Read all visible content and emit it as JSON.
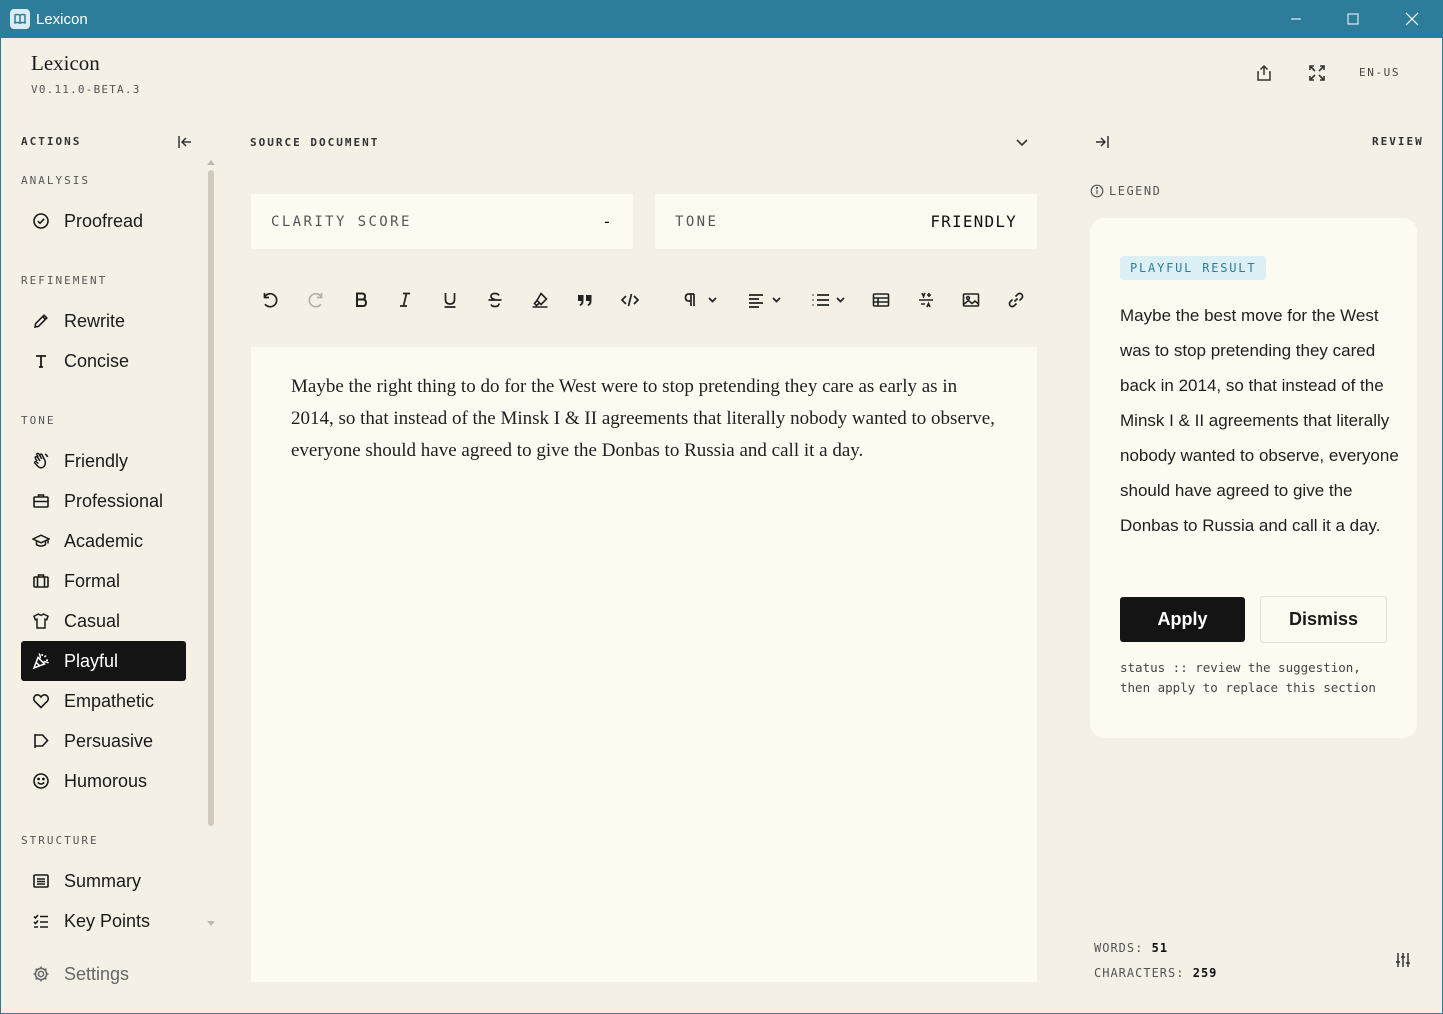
{
  "window": {
    "title": "Lexicon"
  },
  "header": {
    "brand": "Lexicon",
    "version": "V0.11.0-BETA.3",
    "language": "EN-US"
  },
  "sidebar": {
    "title": "ACTIONS",
    "groups": {
      "analysis": {
        "label": "ANALYSIS",
        "items": [
          "Proofread"
        ]
      },
      "refinement": {
        "label": "REFINEMENT",
        "items": [
          "Rewrite",
          "Concise"
        ]
      },
      "tone": {
        "label": "TONE",
        "items": [
          "Friendly",
          "Professional",
          "Academic",
          "Formal",
          "Casual",
          "Playful",
          "Empathetic",
          "Persuasive",
          "Humorous"
        ],
        "active": "Playful"
      },
      "structure": {
        "label": "STRUCTURE",
        "items": [
          "Summary",
          "Key Points"
        ]
      }
    },
    "settings": "Settings"
  },
  "main": {
    "title": "SOURCE DOCUMENT",
    "clarity": {
      "label": "CLARITY SCORE",
      "value": "-"
    },
    "tone": {
      "label": "TONE",
      "value": "FRIENDLY"
    },
    "document": "Maybe the right thing to do for the West were to stop pretending they care as early as in 2014, so that instead of the Minsk I & II agreements that literally nobody wanted to observe, everyone should have agreed to give the Donbas to Russia and call it a day."
  },
  "review": {
    "title": "REVIEW",
    "legend": "LEGEND",
    "badge": "PLAYFUL RESULT",
    "result": "Maybe the best move for the West was to stop pretending they cared back in 2014, so that instead of the Minsk I & II agreements that literally nobody wanted to observe, everyone should have agreed to give the Donbas to Russia and call it a day.",
    "apply": "Apply",
    "dismiss": "Dismiss",
    "status": "status :: review the suggestion, then apply to replace this section",
    "words_label": "WORDS:",
    "words": "51",
    "chars_label": "CHARACTERS:",
    "chars": "259"
  },
  "colors": {
    "titlebar": "#2d7d9a",
    "background": "#f5f0e6",
    "panel": "#fdfaf1",
    "active": "#141414",
    "badge_text": "#2d7d9a",
    "badge_bg": "#dceff4"
  }
}
